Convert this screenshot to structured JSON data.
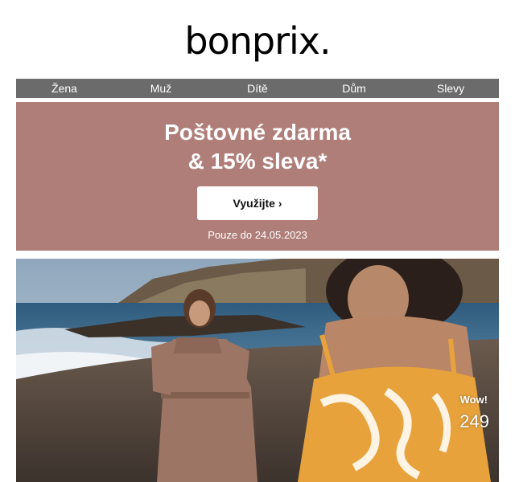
{
  "logo": {
    "text": "bonprix."
  },
  "nav": {
    "items": [
      {
        "label": "Žena"
      },
      {
        "label": "Muž"
      },
      {
        "label": "Dítě"
      },
      {
        "label": "Dům"
      },
      {
        "label": "Slevy"
      }
    ]
  },
  "promo": {
    "title_line1": "Poštovné zdarma",
    "title_line2": "& 15% sleva*",
    "button_label": "Využijte ›",
    "note": "Pouze do 24.05.2023",
    "background_color": "#b07e78"
  },
  "hero": {
    "badge": "Wow!",
    "price": "249"
  }
}
